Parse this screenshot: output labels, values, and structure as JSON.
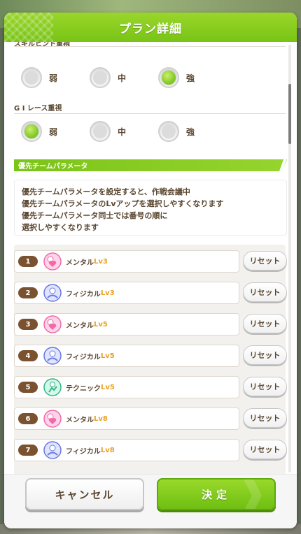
{
  "dialog": {
    "title": "プラン詳細"
  },
  "sections": {
    "first_title_partial": "スキルヒント重視",
    "first_options": [
      "弱",
      "中",
      "強"
    ],
    "first_selected_index": 2,
    "g1_title": "G I レース重視",
    "g1_options": [
      "弱",
      "中",
      "強"
    ],
    "g1_selected_index": 0
  },
  "params_section": {
    "title": "優先チームパラメータ",
    "info_lines": [
      "優先チームパラメータを設定すると、作戦会議中",
      "優先チームパラメータのLvアップを選択しやすくなります",
      "優先チームパラメータ同士では番号の順に",
      "選択しやすくなります"
    ],
    "reset_label": "リセット",
    "items": [
      {
        "num": "1",
        "name": "メンタル",
        "lv": "Lv3",
        "icon": "mental-icon"
      },
      {
        "num": "2",
        "name": "フィジカル",
        "lv": "Lv3",
        "icon": "physical-icon"
      },
      {
        "num": "3",
        "name": "メンタル",
        "lv": "Lv5",
        "icon": "mental-icon"
      },
      {
        "num": "4",
        "name": "フィジカル",
        "lv": "Lv5",
        "icon": "physical-icon"
      },
      {
        "num": "5",
        "name": "テクニック",
        "lv": "Lv5",
        "icon": "technique-icon"
      },
      {
        "num": "6",
        "name": "メンタル",
        "lv": "Lv8",
        "icon": "mental-icon"
      },
      {
        "num": "7",
        "name": "フィジカル",
        "lv": "Lv8",
        "icon": "physical-icon"
      }
    ]
  },
  "footer": {
    "cancel_label": "キャンセル",
    "ok_label": "決定"
  },
  "colors": {
    "accent_green": "#7cc320",
    "text_brown": "#5a4630",
    "lv_orange": "#e8a020",
    "badge_brown": "#7a5230"
  }
}
